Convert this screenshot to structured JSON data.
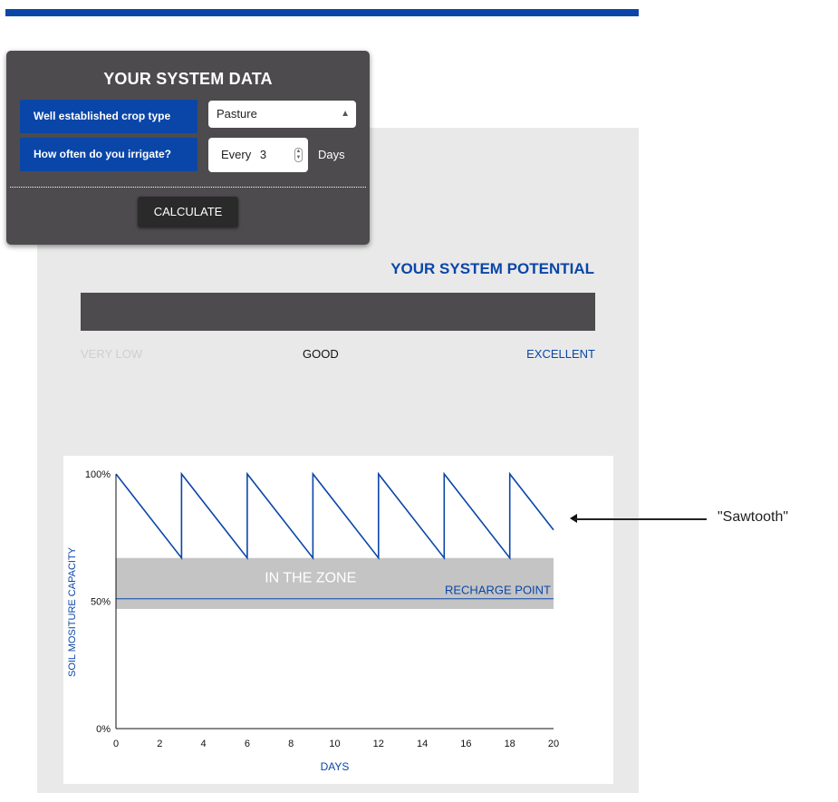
{
  "system_data": {
    "title": "YOUR SYSTEM DATA",
    "crop_label": "Well established crop type",
    "crop_value": "Pasture",
    "irrigate_label": "How often do you irrigate?",
    "irrigate_prefix": "Every",
    "irrigate_value": "3",
    "irrigate_unit": "Days",
    "calculate_label": "CALCULATE"
  },
  "potential": {
    "title": "YOUR SYSTEM POTENTIAL",
    "scale_low": "VERY LOW",
    "scale_mid": "GOOD",
    "scale_high": "EXCELLENT"
  },
  "annotation": {
    "text": "\"Sawtooth\""
  },
  "colors": {
    "brand_blue": "#0a46a8",
    "card_gray": "#4d4b4d",
    "zone_gray": "#c4c4c4"
  },
  "chart_data": {
    "type": "line",
    "xlabel": "DAYS",
    "ylabel": "SOIL MOSITURE CAPACITY",
    "xlim": [
      0,
      20
    ],
    "ylim": [
      0,
      100
    ],
    "x_ticks": [
      "0",
      "2",
      "4",
      "6",
      "8",
      "10",
      "12",
      "14",
      "16",
      "18",
      "20"
    ],
    "y_ticks": [
      "0%",
      "50%",
      "100%"
    ],
    "zone": {
      "label": "IN THE ZONE",
      "from": 47,
      "to": 67
    },
    "recharge": {
      "label": "RECHARGE POINT",
      "value": 51
    },
    "series": [
      {
        "x": [
          0,
          3,
          3,
          6,
          6,
          9,
          9,
          12,
          12,
          15,
          15,
          18,
          18,
          20
        ],
        "y": [
          100,
          67,
          100,
          67,
          100,
          67,
          100,
          67,
          100,
          67,
          100,
          67,
          100,
          78
        ]
      }
    ]
  }
}
